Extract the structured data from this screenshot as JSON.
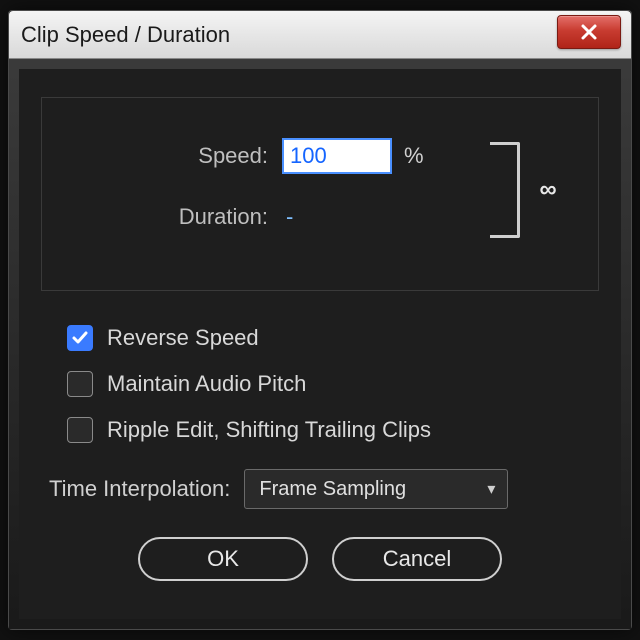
{
  "window": {
    "title": "Clip Speed / Duration"
  },
  "speed": {
    "label": "Speed:",
    "value": "100",
    "unit": "%"
  },
  "duration": {
    "label": "Duration:",
    "value": "-"
  },
  "link": {
    "icon_glyph": "∞"
  },
  "checks": {
    "reverse": {
      "label": "Reverse Speed",
      "checked": true
    },
    "pitch": {
      "label": "Maintain Audio Pitch",
      "checked": false
    },
    "ripple": {
      "label": "Ripple Edit, Shifting Trailing Clips",
      "checked": false
    }
  },
  "interp": {
    "label": "Time Interpolation:",
    "selected": "Frame Sampling"
  },
  "buttons": {
    "ok": "OK",
    "cancel": "Cancel"
  }
}
